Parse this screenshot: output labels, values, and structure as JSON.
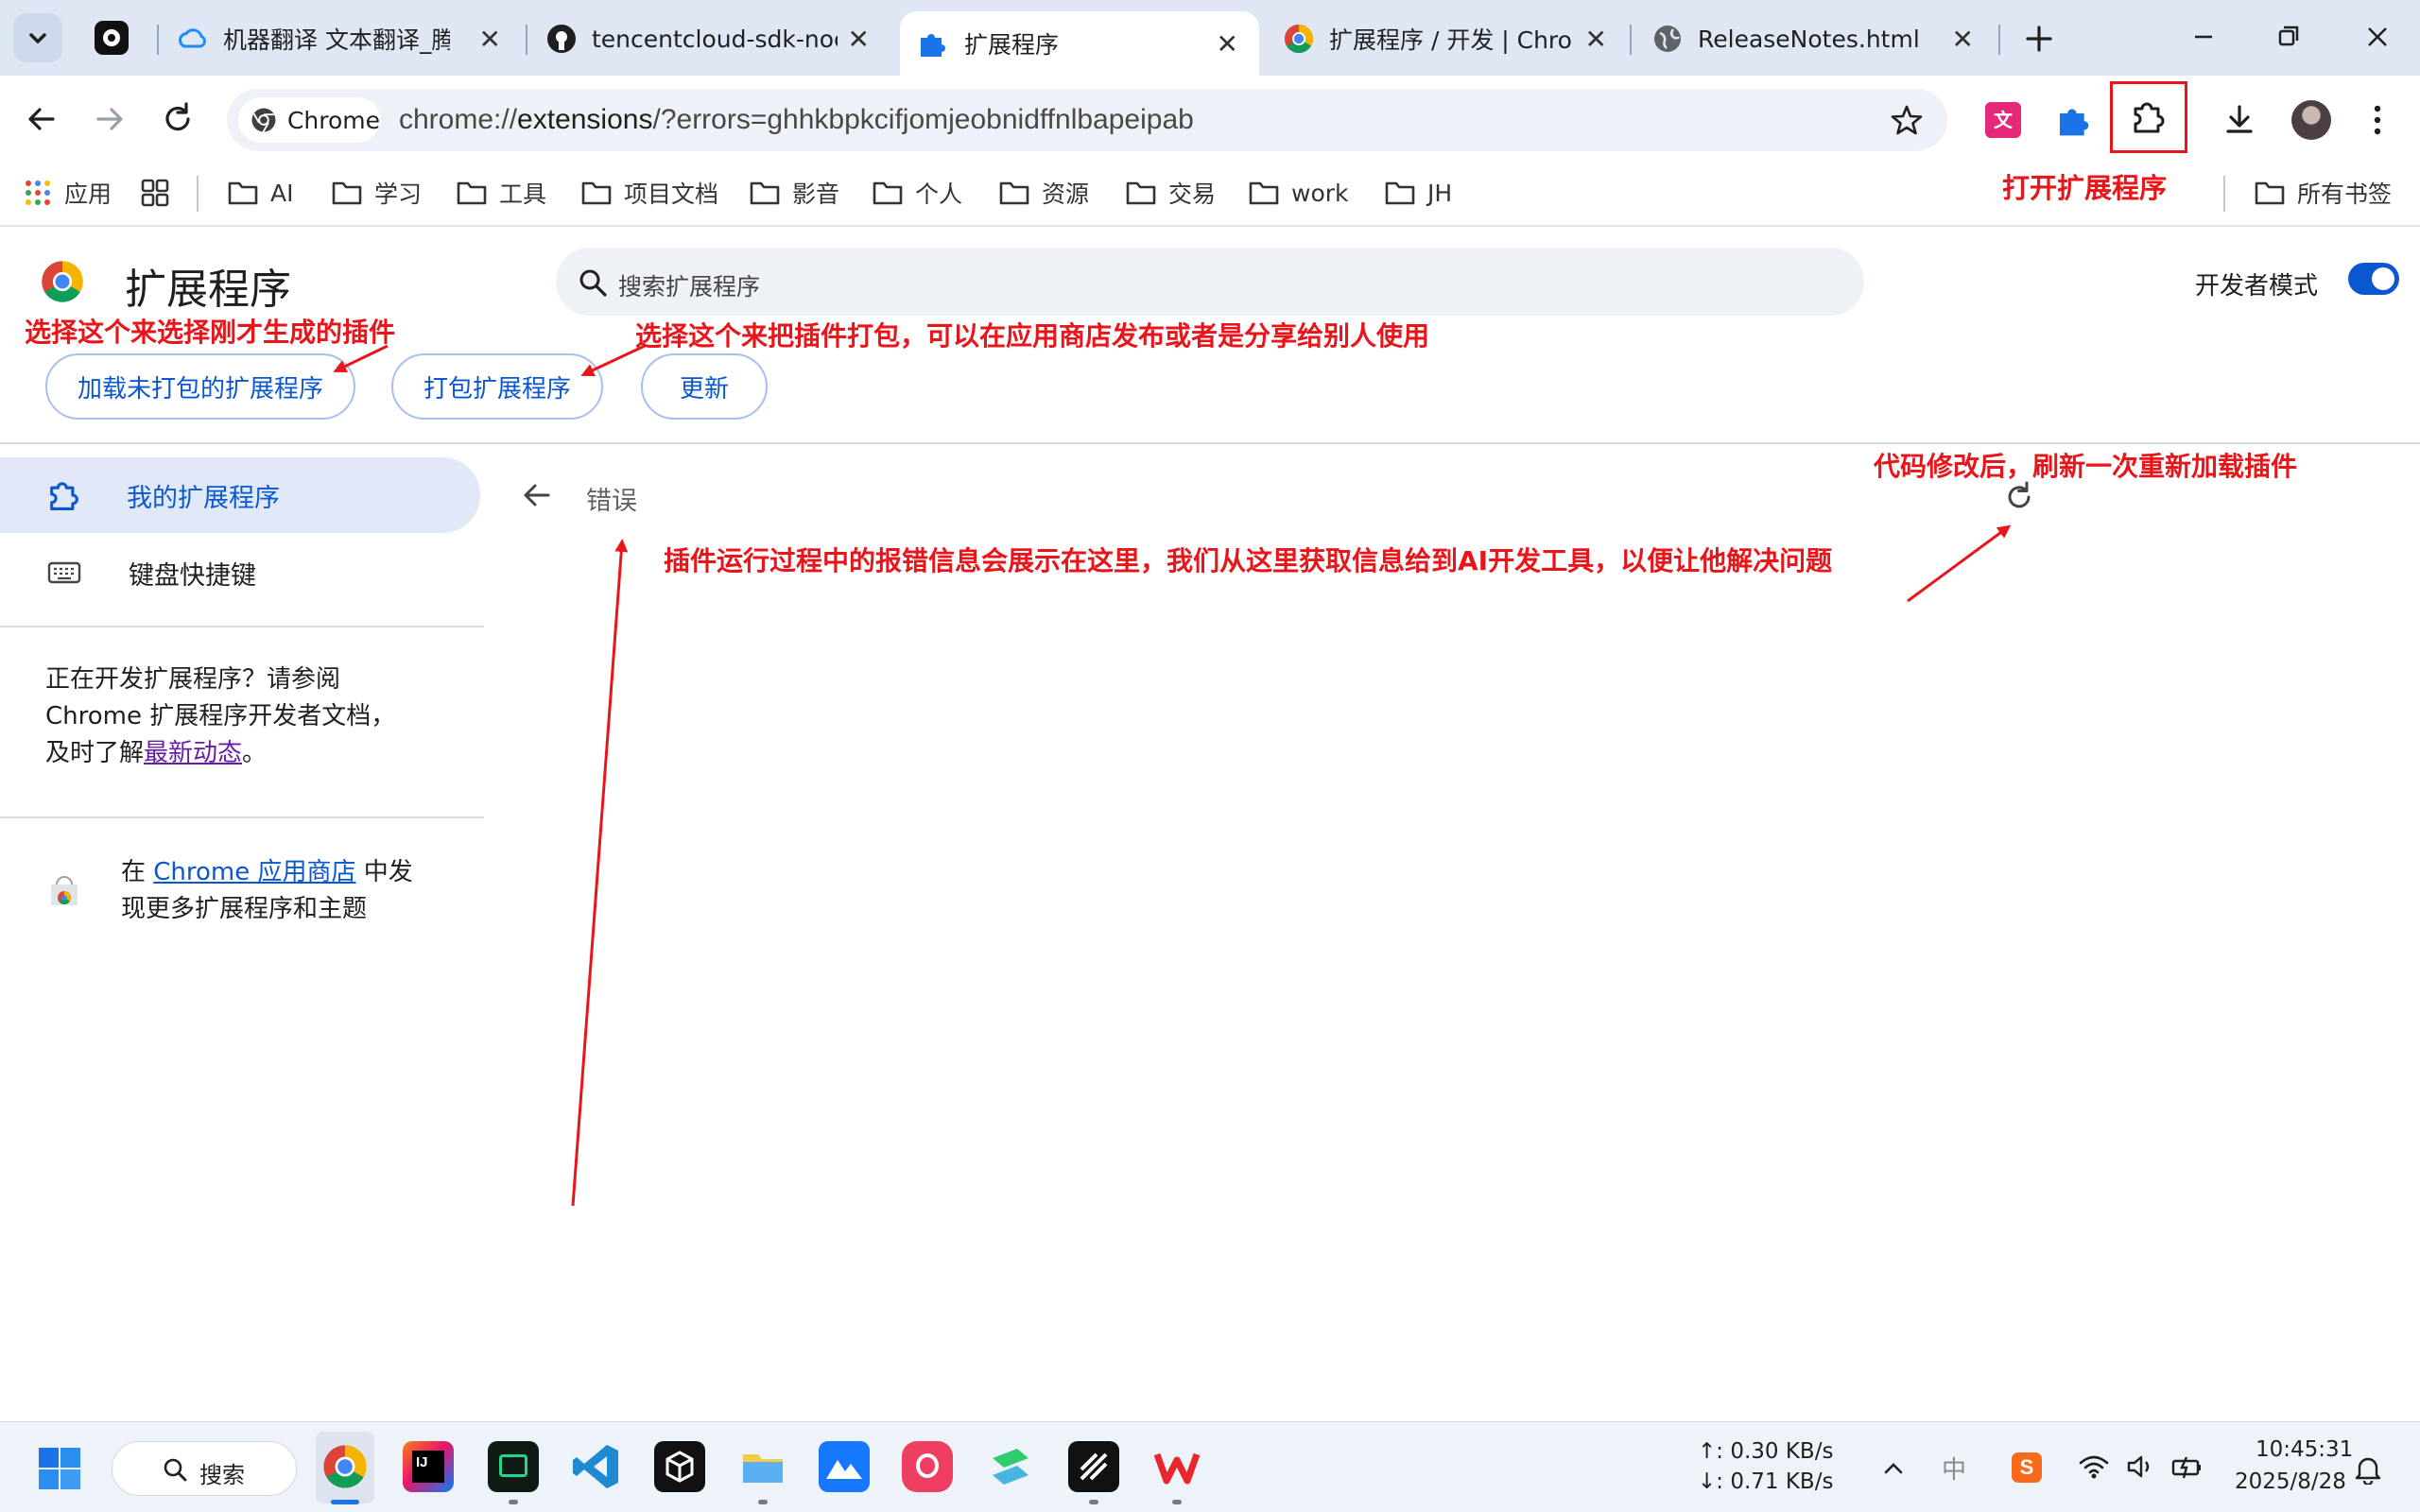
{
  "tabs": [
    {
      "title": "机器翻译 文本翻译_腾讯",
      "active": false
    },
    {
      "title": "tencentcloud-sdk-noc",
      "active": false
    },
    {
      "title": "扩展程序",
      "active": true
    },
    {
      "title": "扩展程序 / 开发 | Chro",
      "active": false
    },
    {
      "title": "ReleaseNotes.html",
      "active": false
    }
  ],
  "toolbar": {
    "chip_label": "Chrome",
    "url_prefix": "chrome://",
    "url_host": "extensions",
    "url_rest": "/?errors=ghhkbpkcifjomjeobnidffnlbapeipab"
  },
  "bookmarks": {
    "apps_label": "应用",
    "folders": [
      "AI",
      "学习",
      "工具",
      "项目文档",
      "影音",
      "个人",
      "资源",
      "交易",
      "work",
      "JH"
    ],
    "all_bookmarks": "所有书签"
  },
  "page": {
    "title": "扩展程序",
    "search_placeholder": "搜索扩展程序",
    "dev_mode_label": "开发者模式",
    "dev_mode_on": true,
    "buttons": {
      "load_unpacked": "加载未打包的扩展程序",
      "pack": "打包扩展程序",
      "update": "更新"
    },
    "errors_title": "错误"
  },
  "sidebar": {
    "items": [
      {
        "label": "我的扩展程序",
        "selected": true
      },
      {
        "label": "键盘快捷键",
        "selected": false
      }
    ],
    "dev_note_1": "正在开发扩展程序？请参阅",
    "dev_note_2": "Chrome 扩展程序开发者文档，",
    "dev_note_3a": "及时了解",
    "dev_note_link": "最新动态",
    "dev_note_3b": "。",
    "store_pre": "在 ",
    "store_link": "Chrome 应用商店",
    "store_post": " 中发",
    "store_line2": "现更多扩展程序和主题"
  },
  "annotations": {
    "open_extensions": "打开扩展程序",
    "choose_load": "选择这个来选择刚才生成的插件",
    "choose_pack": "选择这个来把插件打包，可以在应用商店发布或者是分享给别人使用",
    "refresh_note": "代码修改后，刷新一次重新加载插件",
    "errors_note": "插件运行过程中的报错信息会展示在这里，我们从这里获取信息给到AI开发工具，以便让他解决问题"
  },
  "taskbar": {
    "search_label": "搜索",
    "net_up": "↑: 0.30 KB/s",
    "net_down": "↓: 0.71 KB/s",
    "ime": "中",
    "time": "10:45:31",
    "date": "2025/8/28"
  },
  "colors": {
    "accent": "#0b57d0",
    "annotation": "#e8161b",
    "tabstrip": "#dfe7f5",
    "nav_selected": "#e1e9f8"
  }
}
